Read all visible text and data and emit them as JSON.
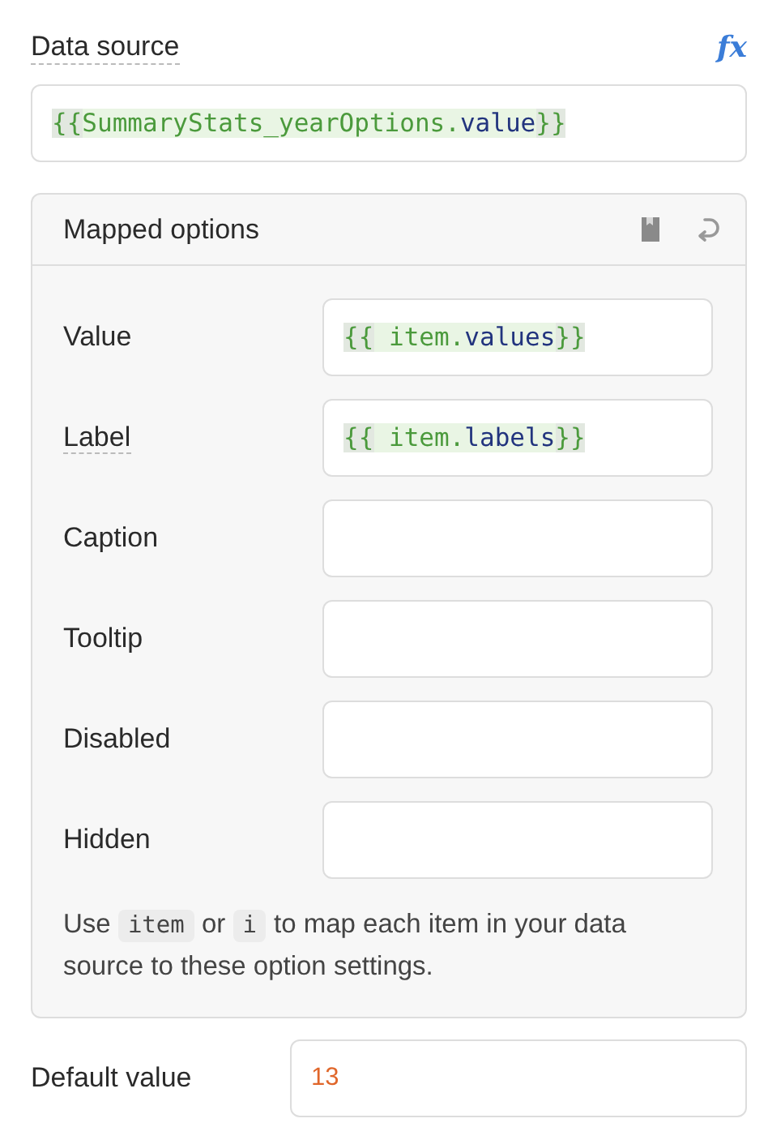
{
  "data_source": {
    "label": "Data source",
    "hint": true,
    "fx": "fx",
    "value": [
      {
        "kind": "punct",
        "text": "{{"
      },
      {
        "kind": "ident",
        "text": "SummaryStats_yearOptions."
      },
      {
        "kind": "prop",
        "text": "value"
      },
      {
        "kind": "punct",
        "text": "}}"
      }
    ]
  },
  "mapped_options": {
    "title": "Mapped options",
    "rows": [
      {
        "label": "Value",
        "hint": false,
        "value": [
          {
            "kind": "punct",
            "text": "{{"
          },
          {
            "kind": "ident",
            "text": " item."
          },
          {
            "kind": "prop",
            "text": "values"
          },
          {
            "kind": "punct",
            "text": "}}"
          }
        ]
      },
      {
        "label": "Label",
        "hint": true,
        "value": [
          {
            "kind": "punct",
            "text": "{{"
          },
          {
            "kind": "ident",
            "text": " item."
          },
          {
            "kind": "prop",
            "text": "labels"
          },
          {
            "kind": "punct",
            "text": "}}"
          }
        ]
      },
      {
        "label": "Caption",
        "hint": false,
        "value": []
      },
      {
        "label": "Tooltip",
        "hint": false,
        "value": []
      },
      {
        "label": "Disabled",
        "hint": false,
        "value": []
      },
      {
        "label": "Hidden",
        "hint": false,
        "value": []
      }
    ],
    "help": [
      {
        "kind": "text",
        "text": "Use "
      },
      {
        "kind": "code",
        "text": "item"
      },
      {
        "kind": "text",
        "text": " or "
      },
      {
        "kind": "code",
        "text": "i"
      },
      {
        "kind": "text",
        "text": " to map each item in your data source to these option settings."
      }
    ]
  },
  "default_value": {
    "label": "Default value",
    "hint": false,
    "value": [
      {
        "kind": "number",
        "text": "13"
      }
    ]
  }
}
